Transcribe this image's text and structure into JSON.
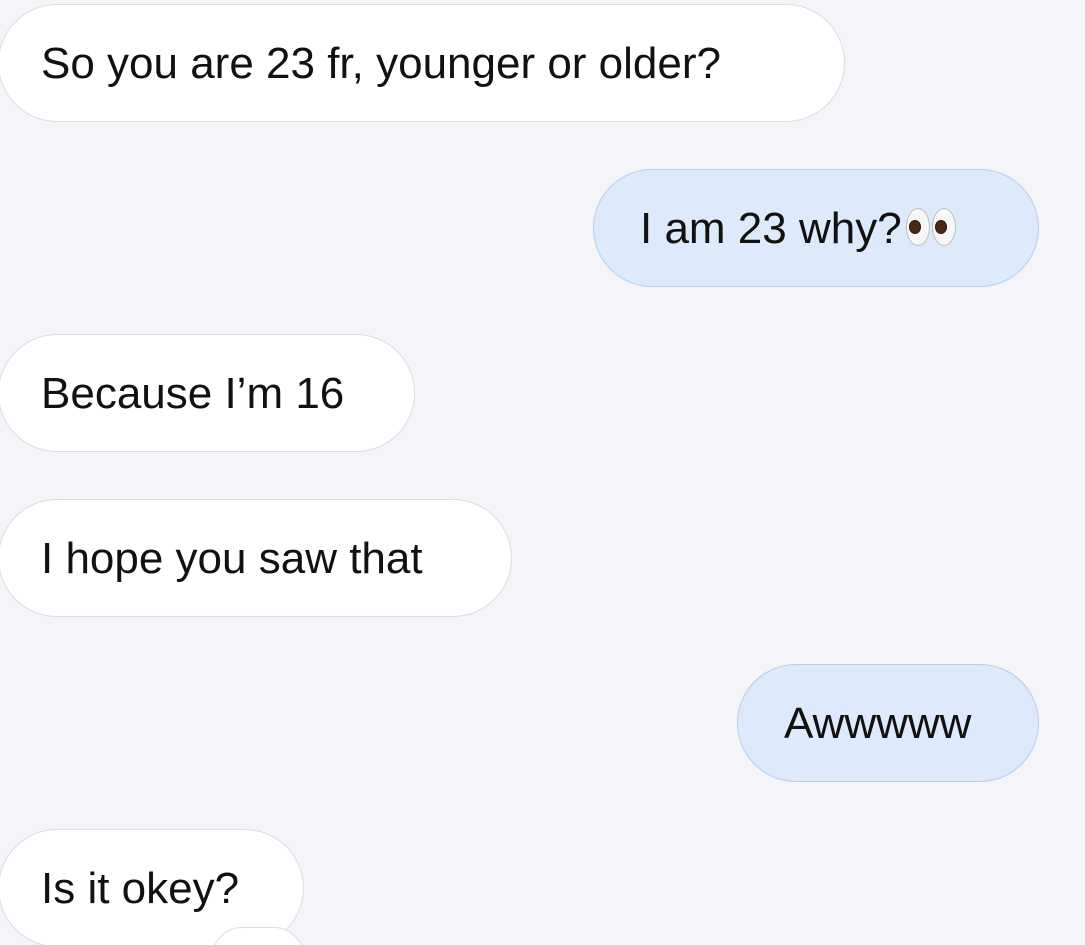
{
  "conversation": {
    "messages": [
      {
        "direction": "incoming",
        "text": "So you are 23 fr, younger or older?"
      },
      {
        "direction": "outgoing",
        "text": "I am 23 why?",
        "emoji": "eyes-emoji"
      },
      {
        "direction": "incoming",
        "text": "Because I’m 16"
      },
      {
        "direction": "incoming",
        "text": "I hope you saw that"
      },
      {
        "direction": "outgoing",
        "text": "Awwwww"
      },
      {
        "direction": "incoming",
        "text": "Is it okey?"
      }
    ]
  },
  "colors": {
    "background": "#f4f4f9",
    "incoming_bubble": "#ffffff",
    "outgoing_bubble": "#dceafb",
    "text": "#111111"
  }
}
